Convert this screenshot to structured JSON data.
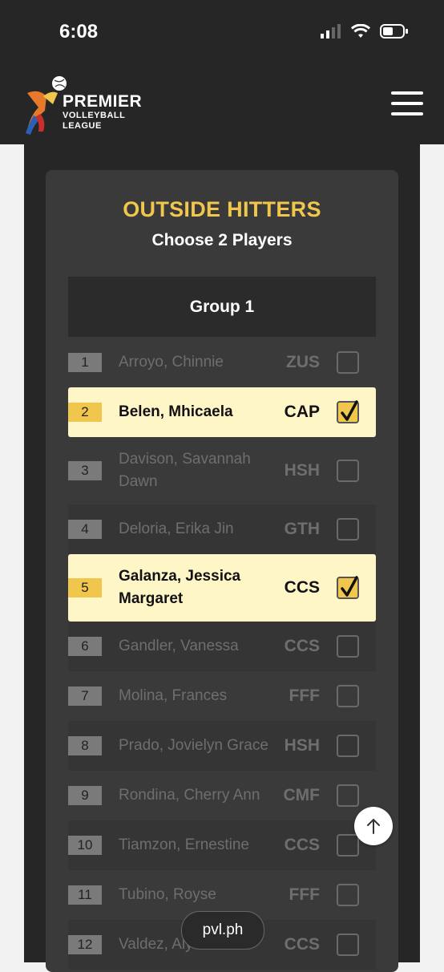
{
  "status": {
    "time": "6:08"
  },
  "logo": {
    "line1": "PREMIER",
    "line2": "VOLLEYBALL",
    "line3": "LEAGUE"
  },
  "section": {
    "title": "OUTSIDE HITTERS",
    "subtitle": "Choose 2 Players",
    "group": "Group 1"
  },
  "players": [
    {
      "num": "1",
      "name": "Arroyo, Chinnie",
      "team": "ZUS",
      "checked": false
    },
    {
      "num": "2",
      "name": "Belen, Mhicaela",
      "team": "CAP",
      "checked": true
    },
    {
      "num": "3",
      "name": "Davison, Savannah Dawn",
      "team": "HSH",
      "checked": false
    },
    {
      "num": "4",
      "name": "Deloria, Erika Jin",
      "team": "GTH",
      "checked": false
    },
    {
      "num": "5",
      "name": "Galanza, Jessica Margaret",
      "team": "CCS",
      "checked": true
    },
    {
      "num": "6",
      "name": "Gandler, Vanessa",
      "team": "CCS",
      "checked": false
    },
    {
      "num": "7",
      "name": "Molina, Frances",
      "team": "FFF",
      "checked": false
    },
    {
      "num": "8",
      "name": "Prado, Jovielyn Grace",
      "team": "HSH",
      "checked": false
    },
    {
      "num": "9",
      "name": "Rondina, Cherry Ann",
      "team": "CMF",
      "checked": false
    },
    {
      "num": "10",
      "name": "Tiamzon, Ernestine",
      "team": "CCS",
      "checked": false
    },
    {
      "num": "11",
      "name": "Tubino, Royse",
      "team": "FFF",
      "checked": false
    },
    {
      "num": "12",
      "name": "Valdez, Alyssa",
      "team": "CCS",
      "checked": false
    }
  ],
  "browser": {
    "url": "pvl.ph"
  },
  "colors": {
    "accent": "#f0c64c",
    "selected_row": "#fff6c8",
    "header_bg": "#262626"
  }
}
